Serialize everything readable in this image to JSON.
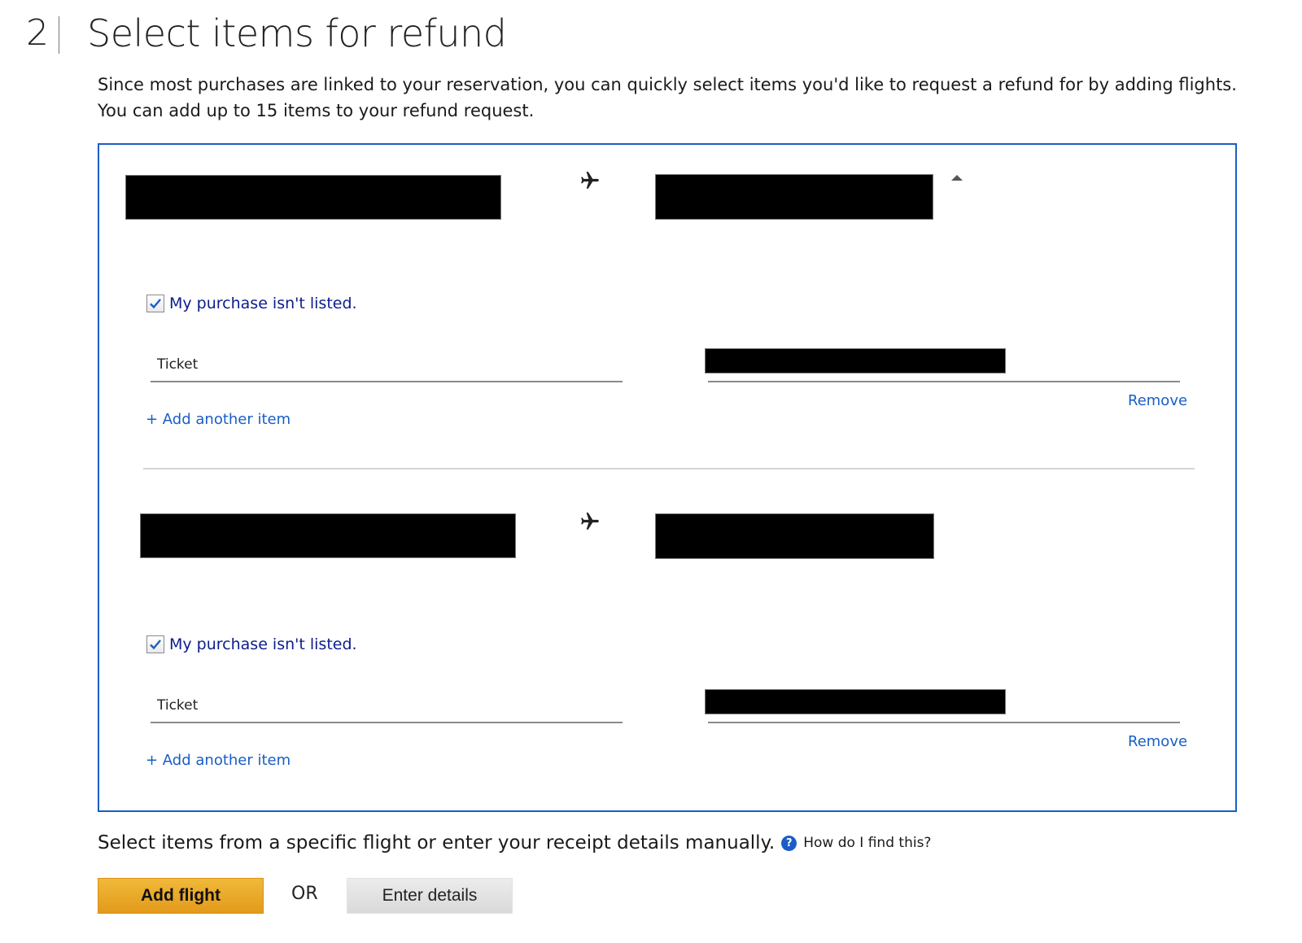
{
  "step": {
    "number": "2",
    "title": "Select items for refund"
  },
  "intro": "Since most purchases are linked to your reservation, you can quickly select items you'd like to request a refund for by adding flights. You can add up to 15 items to your refund request.",
  "flights": [
    {
      "origin": "[redacted]",
      "destination": "[redacted]",
      "icons": {
        "plane": "airplane-icon",
        "collapse": "caret-up-icon"
      },
      "checkbox_label": "My purchase isn't listed.",
      "checked": true,
      "item_type": "Ticket",
      "item_detail": "[redacted]",
      "remove_label": "Remove",
      "add_item_label": "+ Add another item"
    },
    {
      "origin": "[redacted]",
      "destination": "[redacted]",
      "icons": {
        "plane": "airplane-icon"
      },
      "checkbox_label": "My purchase isn't listed.",
      "checked": true,
      "item_type": "Ticket",
      "item_detail": "[redacted]",
      "remove_label": "Remove",
      "add_item_label": "+ Add another item"
    }
  ],
  "footer": {
    "prompt": "Select items from a specific flight or enter your receipt details manually.",
    "help_icon": "?",
    "help_link": "How do I find this?",
    "add_flight_label": "Add flight",
    "or_label": "OR",
    "enter_details_label": "Enter details"
  },
  "colors": {
    "accent_blue": "#1a5ec4",
    "checkbox_label": "#0b1d8c",
    "primary_button": "#e8a928",
    "secondary_button": "#e0e0e0"
  }
}
